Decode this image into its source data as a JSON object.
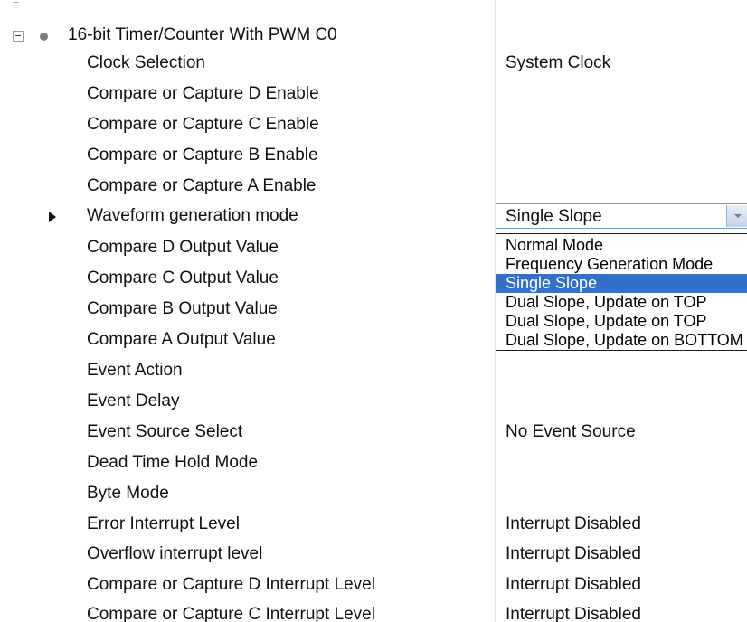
{
  "group": {
    "label": "16-bit Timer/Counter With PWM C0"
  },
  "properties": [
    {
      "name": "Clock Selection",
      "value": "System Clock"
    },
    {
      "name": "Compare or Capture D Enable",
      "value": ""
    },
    {
      "name": "Compare or Capture C Enable",
      "value": ""
    },
    {
      "name": "Compare or Capture B Enable",
      "value": ""
    },
    {
      "name": "Compare or Capture A Enable",
      "value": ""
    },
    {
      "name": "Waveform generation mode",
      "value": "Single Slope"
    },
    {
      "name": "Compare D Output Value",
      "value": ""
    },
    {
      "name": "Compare C Output Value",
      "value": ""
    },
    {
      "name": "Compare B Output Value",
      "value": ""
    },
    {
      "name": "Compare A Output Value",
      "value": ""
    },
    {
      "name": "Event Action",
      "value": ""
    },
    {
      "name": "Event Delay",
      "value": ""
    },
    {
      "name": "Event Source Select",
      "value": "No Event Source"
    },
    {
      "name": "Dead Time Hold Mode",
      "value": ""
    },
    {
      "name": "Byte Mode",
      "value": ""
    },
    {
      "name": "Error Interrupt Level",
      "value": "Interrupt Disabled"
    },
    {
      "name": "Overflow interrupt level",
      "value": "Interrupt Disabled"
    },
    {
      "name": "Compare or Capture D Interrupt Level",
      "value": "Interrupt Disabled"
    },
    {
      "name": "Compare or Capture C Interrupt Level",
      "value": "Interrupt Disabled"
    }
  ],
  "waveform_dropdown": {
    "selected": "Single Slope",
    "options": [
      "Normal Mode",
      "Frequency Generation Mode",
      "Single Slope",
      "Dual Slope, Update on TOP",
      "Dual Slope, Update on TOP",
      "Dual Slope, Update on BOTTOM"
    ]
  },
  "icons": {
    "expander": "collapse-minus-icon",
    "group_bullet": "bullet-icon",
    "current_row": "row-pointer-icon",
    "dropdown_button": "chevron-down-icon"
  },
  "colors": {
    "selection": "#3470c8",
    "combo_border": "#7a9cc4",
    "divider": "#e6e6e6"
  }
}
